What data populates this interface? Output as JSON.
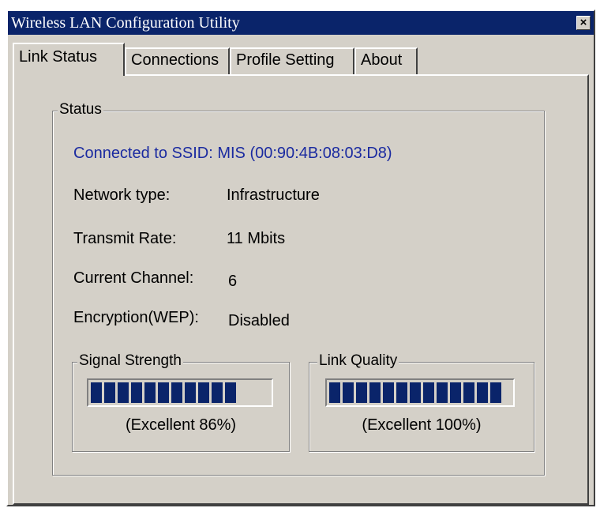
{
  "window": {
    "title": "Wireless LAN Configuration Utility",
    "close_label": "×"
  },
  "tabs": [
    {
      "label": "Link Status",
      "active": true
    },
    {
      "label": "Connections",
      "active": false
    },
    {
      "label": "Profile Setting",
      "active": false
    },
    {
      "label": "About",
      "active": false
    }
  ],
  "status": {
    "group_label": "Status",
    "connected_text": "Connected to SSID: MIS (00:90:4B:08:03:D8)",
    "rows": [
      {
        "label": "Network type:",
        "value": "Infrastructure"
      },
      {
        "label": "Transmit Rate:",
        "value": "11 Mbits"
      },
      {
        "label": "Current Channel:",
        "value": "6"
      },
      {
        "label": "Encryption(WEP):",
        "value": "Disabled"
      }
    ]
  },
  "signal_strength": {
    "group_label": "Signal Strength",
    "caption": "(Excellent 86%)",
    "percent": 86
  },
  "link_quality": {
    "group_label": "Link Quality",
    "caption": "(Excellent 100%)",
    "percent": 100
  },
  "colors": {
    "titlebar": "#0a246a",
    "ssid_text": "#1a2aa0",
    "progress_fill": "#0a246a",
    "face": "#d4d0c8"
  }
}
